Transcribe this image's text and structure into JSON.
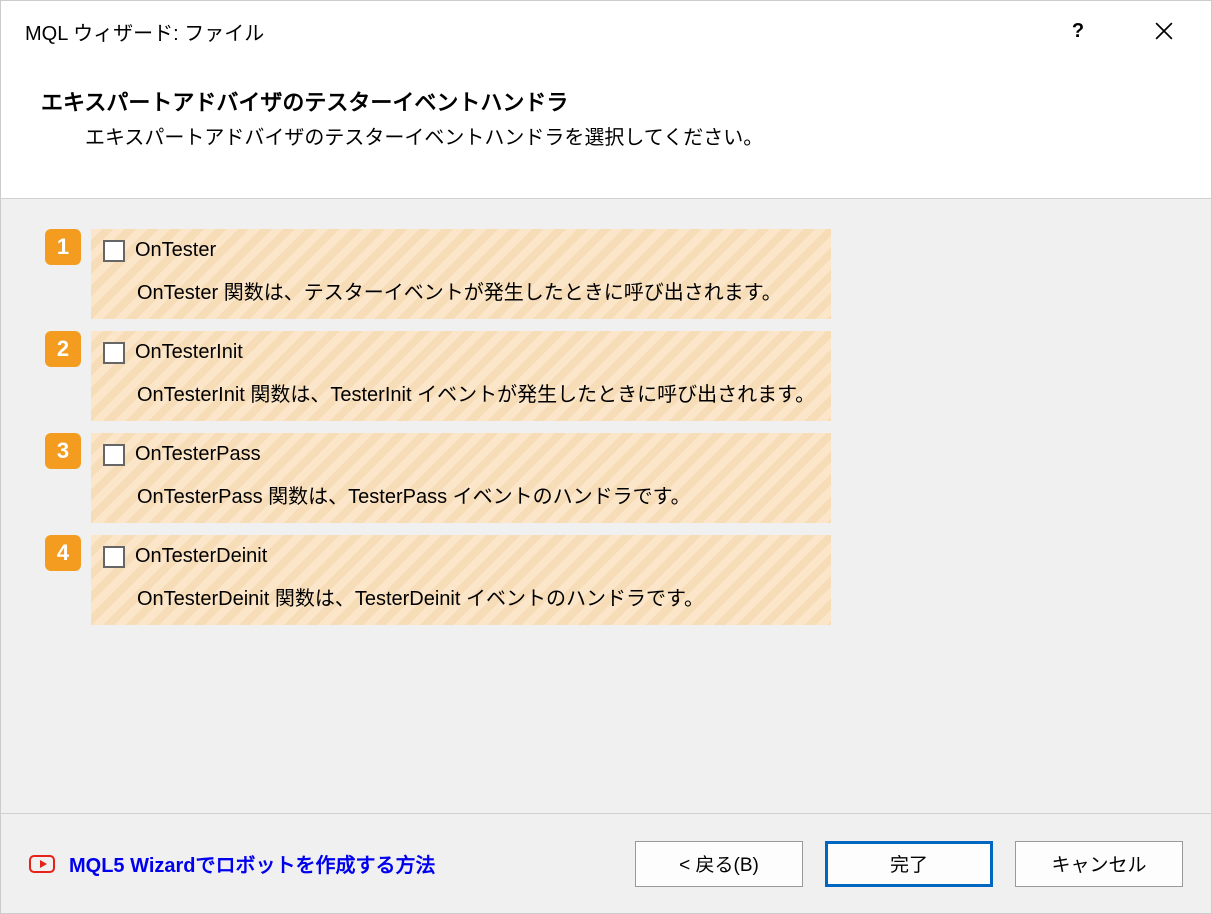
{
  "titlebar": {
    "title": "MQL ウィザード: ファイル",
    "help_label": "?",
    "close_label": "×"
  },
  "header": {
    "title": "エキスパートアドバイザのテスターイベントハンドラ",
    "subtitle": "エキスパートアドバイザのテスターイベントハンドラを選択してください。"
  },
  "options": [
    {
      "number": "1",
      "label": "OnTester",
      "description": "OnTester 関数は、テスターイベントが発生したときに呼び出されます。"
    },
    {
      "number": "2",
      "label": "OnTesterInit",
      "description": "OnTesterInit 関数は、TesterInit イベントが発生したときに呼び出されます。"
    },
    {
      "number": "3",
      "label": "OnTesterPass",
      "description": "OnTesterPass 関数は、TesterPass イベントのハンドラです。"
    },
    {
      "number": "4",
      "label": "OnTesterDeinit",
      "description": "OnTesterDeinit 関数は、TesterDeinit イベントのハンドラです。"
    }
  ],
  "footer": {
    "link_text": "MQL5 Wizardでロボットを作成する方法",
    "back_label": "< 戻る(B)",
    "finish_label": "完了",
    "cancel_label": "キャンセル"
  }
}
